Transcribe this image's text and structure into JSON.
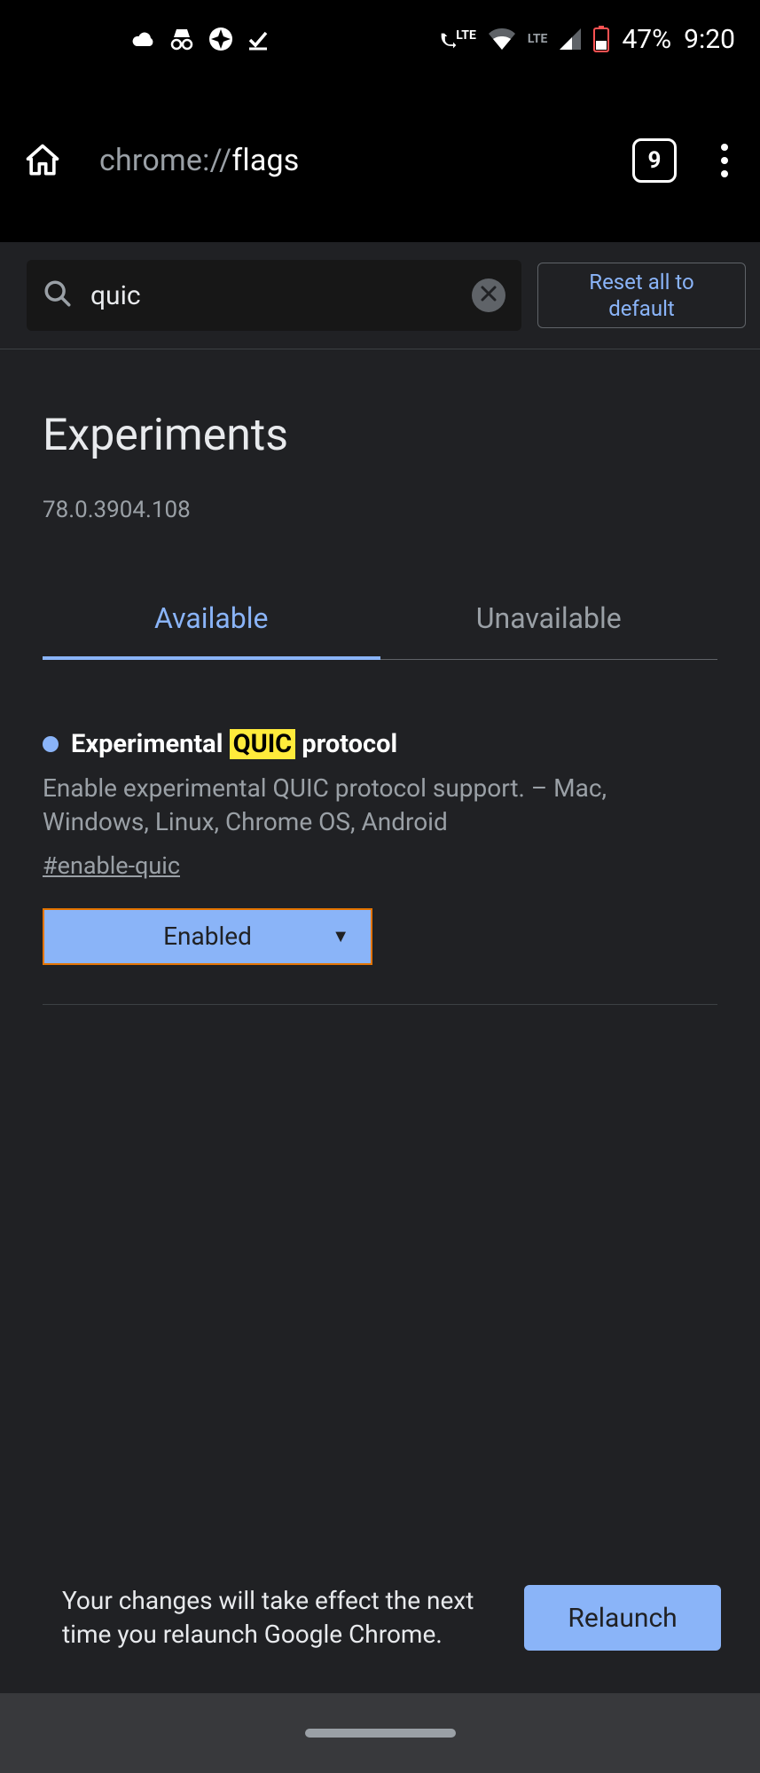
{
  "status": {
    "lte_label": "LTE",
    "battery_pct": "47%",
    "time": "9:20"
  },
  "toolbar": {
    "url_prefix": "chrome://",
    "url_strong": "flags",
    "tab_count": "9"
  },
  "search": {
    "value": "quic",
    "reset_line1": "Reset all to",
    "reset_line2": "default"
  },
  "page": {
    "title": "Experiments",
    "version": "78.0.3904.108"
  },
  "tabs": {
    "available": "Available",
    "unavailable": "Unavailable"
  },
  "experiment": {
    "title_pre": "Experimental ",
    "title_hl": "QUIC",
    "title_post": " protocol",
    "desc": "Enable experimental QUIC protocol support. – Mac, Windows, Linux, Chrome OS, Android",
    "anchor": "#enable-quic",
    "select_value": "Enabled"
  },
  "relaunch": {
    "message": "Your changes will take effect the next time you relaunch Google Chrome.",
    "button": "Relaunch"
  }
}
